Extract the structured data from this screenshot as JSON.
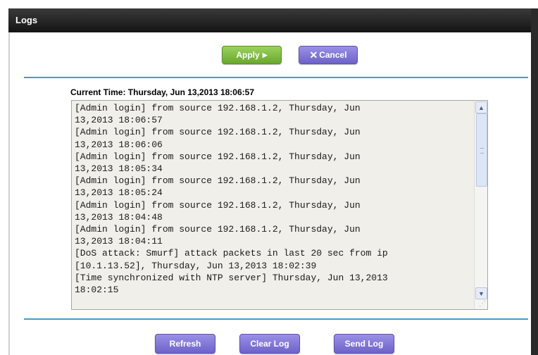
{
  "window": {
    "title": "Logs"
  },
  "toolbar": {
    "apply_label": "Apply",
    "apply_arrow": "▶",
    "cancel_symbol": "✕",
    "cancel_label": "Cancel"
  },
  "status": {
    "current_time": "Current Time: Thursday, Jun 13,2013 18:06:57"
  },
  "log": {
    "text": "[Admin login] from source 192.168.1.2, Thursday, Jun\n13,2013 18:06:57\n[Admin login] from source 192.168.1.2, Thursday, Jun\n13,2013 18:06:06\n[Admin login] from source 192.168.1.2, Thursday, Jun\n13,2013 18:05:34\n[Admin login] from source 192.168.1.2, Thursday, Jun\n13,2013 18:05:24\n[Admin login] from source 192.168.1.2, Thursday, Jun\n13,2013 18:04:48\n[Admin login] from source 192.168.1.2, Thursday, Jun\n13,2013 18:04:11\n[DoS attack: Smurf] attack packets in last 20 sec from ip\n[10.1.13.52], Thursday, Jun 13,2013 18:02:39\n[Time synchronized with NTP server] Thursday, Jun 13,2013\n18:02:15"
  },
  "footer": {
    "refresh_label": "Refresh",
    "clear_label": "Clear Log",
    "send_label": "Send Log"
  },
  "icons": {
    "scroll_up": "chevron-up-icon",
    "scroll_down": "chevron-down-icon",
    "resize": "resize-grip-icon"
  },
  "colors": {
    "apply": "#7dbb3f",
    "purple": "#7e73d6",
    "divider": "#3aa0cf",
    "titlebar": "#1e1e1e"
  }
}
